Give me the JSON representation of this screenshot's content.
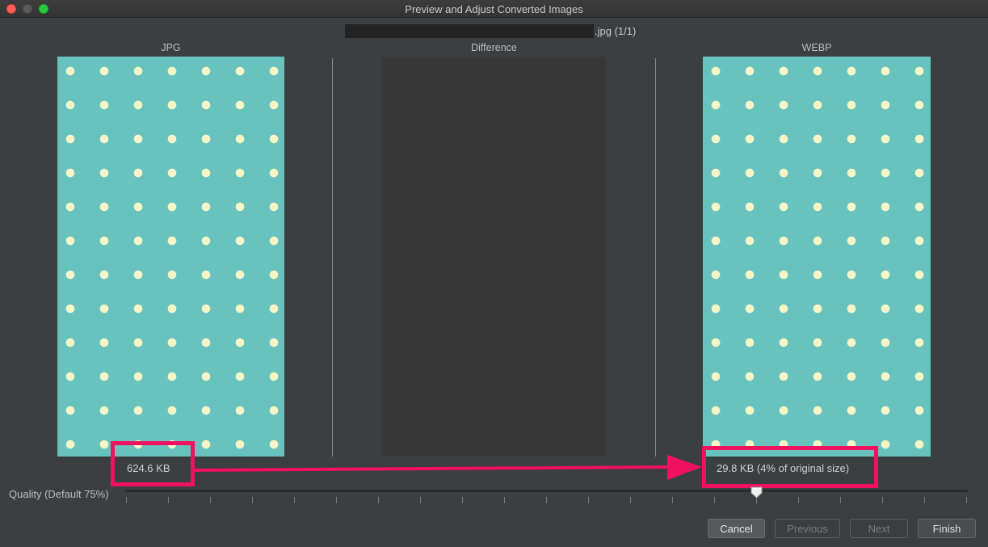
{
  "window": {
    "title": "Preview and Adjust Converted Images"
  },
  "file": {
    "name_suffix": ".jpg (1/1)"
  },
  "columns": {
    "original_label": "JPG",
    "difference_label": "Difference",
    "converted_label": "WEBP"
  },
  "sizes": {
    "original": "624.6 KB",
    "converted": "29.8 KB (4% of original size)"
  },
  "quality": {
    "label": "Quality (Default 75%)",
    "value_percent": 75
  },
  "buttons": {
    "cancel": "Cancel",
    "previous": "Previous",
    "next": "Next",
    "finish": "Finish"
  },
  "colors": {
    "highlight": "#f0115f",
    "pattern_bg": "#68c3bf",
    "pattern_dot": "#f6f5c8"
  }
}
